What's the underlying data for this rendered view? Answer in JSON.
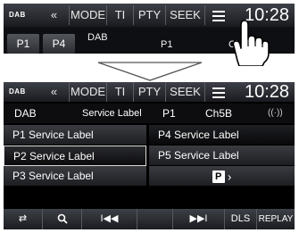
{
  "screen_before": {
    "logo": "DAB",
    "toolbar": [
      "«",
      "MODE",
      "TI",
      "PTY",
      "SEEK"
    ],
    "menu_icon": "menu-icon",
    "clock": "10:28",
    "row2": {
      "presets": [
        "P1",
        "P4"
      ],
      "band": "DAB",
      "preset": "P1",
      "channel": "Ch5B"
    }
  },
  "screen_after": {
    "logo": "DAB",
    "toolbar": [
      "«",
      "MODE",
      "TI",
      "PTY",
      "SEEK"
    ],
    "menu_icon": "menu-icon",
    "clock": "10:28",
    "info": {
      "band": "DAB",
      "service": "Service Label",
      "preset": "P1",
      "channel": "Ch5B"
    },
    "presets_left": [
      "P1 Service Label",
      "P2 Service Label",
      "P3 Service Label"
    ],
    "presets_right": [
      "P4 Service Label",
      "P5 Service Label"
    ],
    "next_page_label": "P",
    "controls": {
      "rew": "I◀◀",
      "ff": "▶▶I",
      "dls": "DLS",
      "replay": "REPLAY"
    }
  }
}
